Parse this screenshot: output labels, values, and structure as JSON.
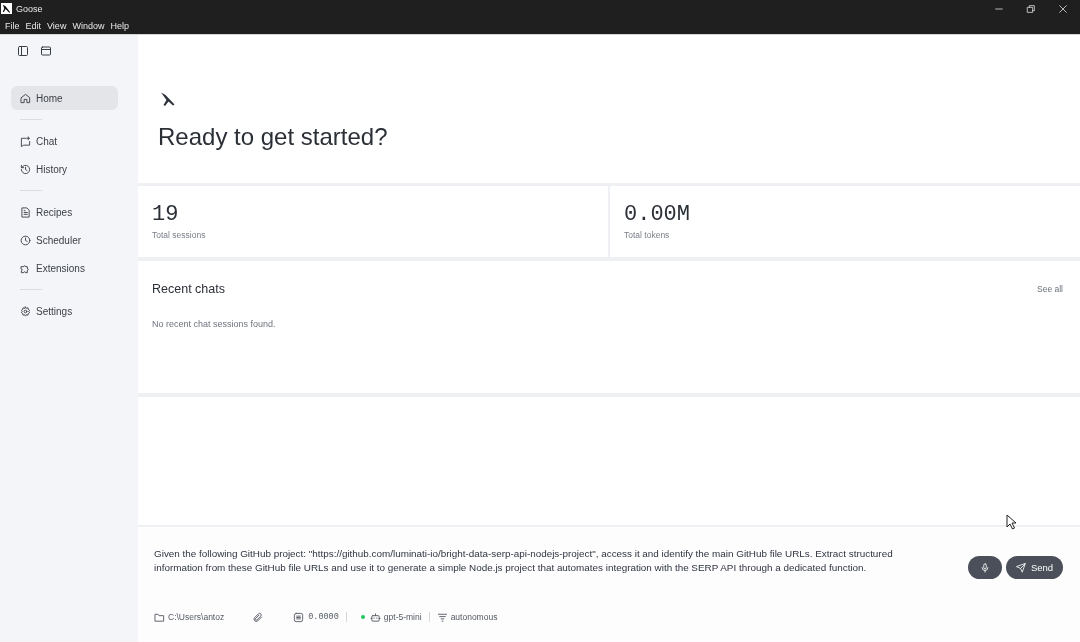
{
  "window": {
    "title": "Goose",
    "menu": [
      {
        "label": "File"
      },
      {
        "label": "Edit"
      },
      {
        "label": "View"
      },
      {
        "label": "Window"
      },
      {
        "label": "Help"
      }
    ]
  },
  "sidebar": {
    "groups": [
      {
        "items": [
          {
            "label": "Home",
            "selected": true
          }
        ]
      },
      {
        "items": [
          {
            "label": "Chat",
            "selected": false
          },
          {
            "label": "History",
            "selected": false
          }
        ]
      },
      {
        "items": [
          {
            "label": "Recipes",
            "selected": false
          },
          {
            "label": "Scheduler",
            "selected": false
          },
          {
            "label": "Extensions",
            "selected": false
          }
        ]
      },
      {
        "items": [
          {
            "label": "Settings",
            "selected": false
          }
        ]
      }
    ]
  },
  "hero": {
    "heading": "Ready to get started?"
  },
  "stats": [
    {
      "value": "19",
      "label": "Total sessions"
    },
    {
      "value": "0.00M",
      "label": "Total tokens"
    }
  ],
  "recent_chats": {
    "title": "Recent chats",
    "link": "See all",
    "empty_message": "No recent chat sessions found."
  },
  "composer": {
    "value": "Given the following GitHub project: \"https://github.com/luminati-io/bright-data-serp-api-nodejs-project\", access it and identify the main GitHub file URLs. Extract structured information from these GitHub file URLs and use it to generate a simple Node.js project that automates integration with the SERP API through a dedicated function.",
    "send_label": "Send"
  },
  "status_bar": {
    "directory": "C:\\Users\\antoz",
    "cost": "0.0000",
    "model": "gpt-5-mini",
    "mode": "autonomous"
  }
}
